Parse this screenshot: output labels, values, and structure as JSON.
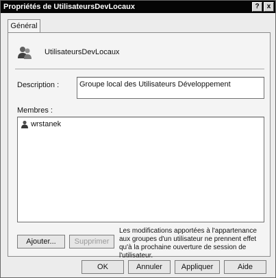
{
  "window": {
    "title": "Propriétés de UtilisateursDevLocaux",
    "help_button": "?",
    "close_button": "x"
  },
  "tabs": [
    {
      "label": "Général"
    }
  ],
  "group": {
    "name": "UtilisateursDevLocaux",
    "icon": "user-group-icon"
  },
  "description": {
    "label": "Description :",
    "value": "Groupe local des Utilisateurs Développement"
  },
  "members": {
    "label": "Membres :",
    "items": [
      {
        "name": "wrstanek",
        "icon": "user-icon"
      }
    ]
  },
  "actions": {
    "add_label": "Ajouter...",
    "remove_label": "Supprimer",
    "note": "Les modifications apportées à l'appartenance aux groupes d'un utilisateur ne prennent effet qu'à la prochaine ouverture de session de l'utilisateur."
  },
  "footer": {
    "ok": "OK",
    "cancel": "Annuler",
    "apply": "Appliquer",
    "help": "Aide"
  }
}
